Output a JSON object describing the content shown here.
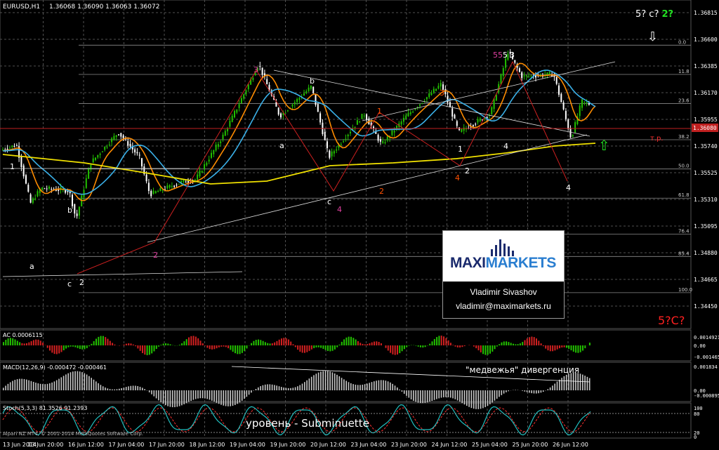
{
  "header": {
    "symbol": "EURUSD,H1",
    "ohlc": "1.36068 1.36090 1.36063 1.36072"
  },
  "colors": {
    "background": "#000000",
    "grid": "#505050",
    "price_line": "#c02020",
    "ma_fast": "#ff8c00",
    "ma_mid": "#3ab0e8",
    "ma_slow": "#f0e000",
    "bull_candle": "#22c000",
    "bear_candle": "#ffffff",
    "wave_lines": "#cc2020",
    "wave_label_pink": "#e040a0",
    "wave_label_orange": "#ff5000",
    "macd_hist": "#c8c8c8",
    "macd_signal": "#ff3030",
    "stoch_main": "#20c0c0",
    "stoch_signal": "#ff3030"
  },
  "chart_data": {
    "type": "candlestick",
    "symbol": "EURUSD",
    "timeframe": "H1",
    "y_ticks": [
      "1.36815",
      "1.36600",
      "1.36385",
      "1.36170",
      "1.35955",
      "1.35740",
      "1.35525",
      "1.35310",
      "1.35095",
      "1.34880",
      "1.34665",
      "1.34450"
    ],
    "current_price_label": "1.36080",
    "x_ticks": [
      "13 Jun 2014",
      "13 Jun 20:00",
      "16 Jun 12:00",
      "17 Jun 04:00",
      "17 Jun 20:00",
      "18 Jun 12:00",
      "19 Jun 04:00",
      "19 Jun 20:00",
      "20 Jun 12:00",
      "23 Jun 04:00",
      "23 Jun 20:00",
      "24 Jun 12:00",
      "25 Jun 04:00",
      "25 Jun 20:00",
      "26 Jun 12:00"
    ],
    "fib_levels": [
      {
        "label": "0.0",
        "price": 1.36553
      },
      {
        "label": "11.8",
        "price": 1.36317
      },
      {
        "label": "23.6",
        "price": 1.36082
      },
      {
        "label": "38.2",
        "price": 1.35791
      },
      {
        "label": "50.0",
        "price": 1.35555
      },
      {
        "label": "61.8",
        "price": 1.3532
      },
      {
        "label": "76.4",
        "price": 1.3503
      },
      {
        "label": "85.4",
        "price": 1.3485
      },
      {
        "label": "100.0",
        "price": 1.34558
      }
    ],
    "tp_label": "т.р.",
    "wave_labels": [
      {
        "text": "1",
        "color": "white"
      },
      {
        "text": "a",
        "color": "white"
      },
      {
        "text": "b",
        "color": "white"
      },
      {
        "text": "c",
        "color": "white"
      },
      {
        "text": "2",
        "color": "white"
      },
      {
        "text": "2",
        "color": "pink"
      },
      {
        "text": "3",
        "color": "pink"
      },
      {
        "text": "b",
        "color": "white"
      },
      {
        "text": "a",
        "color": "white"
      },
      {
        "text": "c",
        "color": "white"
      },
      {
        "text": "4",
        "color": "pink"
      },
      {
        "text": "1",
        "color": "orange"
      },
      {
        "text": "2",
        "color": "orange"
      },
      {
        "text": "3",
        "color": "orange"
      },
      {
        "text": "4",
        "color": "orange"
      },
      {
        "text": "1",
        "color": "white"
      },
      {
        "text": "2",
        "color": "white"
      },
      {
        "text": "4",
        "color": "white"
      },
      {
        "text": "55",
        "color": "pink"
      },
      {
        "text": "5",
        "color": "white"
      },
      {
        "text": "3",
        "color": "white"
      },
      {
        "text": "4",
        "color": "white"
      }
    ],
    "annotations": {
      "top_right_prefix": "5? c? ",
      "top_right_green": "2?",
      "bottom_right": "5?C?"
    },
    "indicators": {
      "ac": {
        "label": "AC 0.0006115",
        "ticks": [
          "0.0014921",
          "0.00",
          "-0.0014654"
        ]
      },
      "macd": {
        "label": "MACD(12,26,9) -0.000472 -0.000461",
        "ticks": [
          "0.001834",
          "0.00",
          "-0.000895"
        ],
        "annotation": "\"медвежья\" дивергенция"
      },
      "stoch": {
        "label": "Stoch(5,3,3) 81.3526 91.2393",
        "ticks": [
          "100",
          "80",
          "20",
          "0"
        ],
        "annotation": "уровень - Subminuette"
      }
    },
    "copyright": "Alpari NZ MT4, © 2001-2014 MetaQuotes Software Corp."
  },
  "logo": {
    "brand_part1": "MAXI",
    "brand_part2": "MARKETS",
    "author": "Vladimir Sivashov",
    "email": "vladimir@maximarkets.ru"
  }
}
